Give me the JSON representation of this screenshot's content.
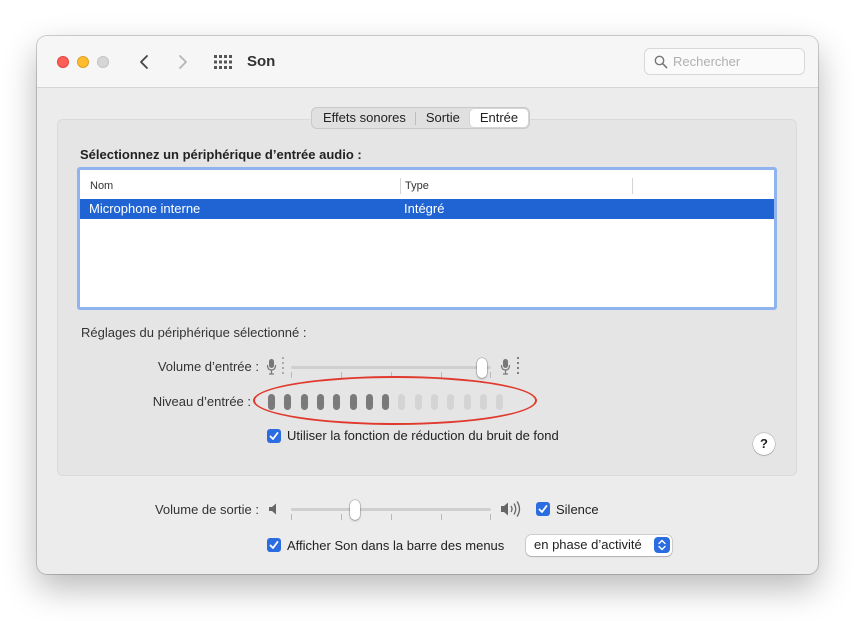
{
  "window": {
    "title": "Son",
    "search_placeholder": "Rechercher"
  },
  "tabs": [
    {
      "label": "Effets sonores",
      "active": false
    },
    {
      "label": "Sortie",
      "active": false
    },
    {
      "label": "Entrée",
      "active": true
    }
  ],
  "input": {
    "section_label": "Sélectionnez un périphérique d’entrée audio :",
    "table": {
      "columns": [
        "Nom",
        "Type"
      ],
      "rows": [
        {
          "name": "Microphone interne",
          "type": "Intégré",
          "selected": true
        }
      ]
    },
    "settings_label": "Réglages du périphérique sélectionné :",
    "volume_label": "Volume d’entrée :",
    "volume_fraction": 0.98,
    "level_label": "Niveau d’entrée :",
    "level_total_bars": 15,
    "level_active_bars": 8,
    "noise_reduction_label": "Utiliser la fonction de réduction du bruit de fond",
    "noise_reduction_checked": true,
    "help_label": "?"
  },
  "output": {
    "volume_label": "Volume de sortie :",
    "volume_fraction": 0.31,
    "mute_label": "Silence",
    "mute_checked": true,
    "menubar_label": "Afficher Son dans la barre des menus",
    "menubar_checked": true,
    "menubar_option": "en phase d’activité"
  },
  "colors": {
    "accent": "#2b6de0",
    "selection": "#2064d3",
    "highlight_oval": "#e03a2f"
  }
}
